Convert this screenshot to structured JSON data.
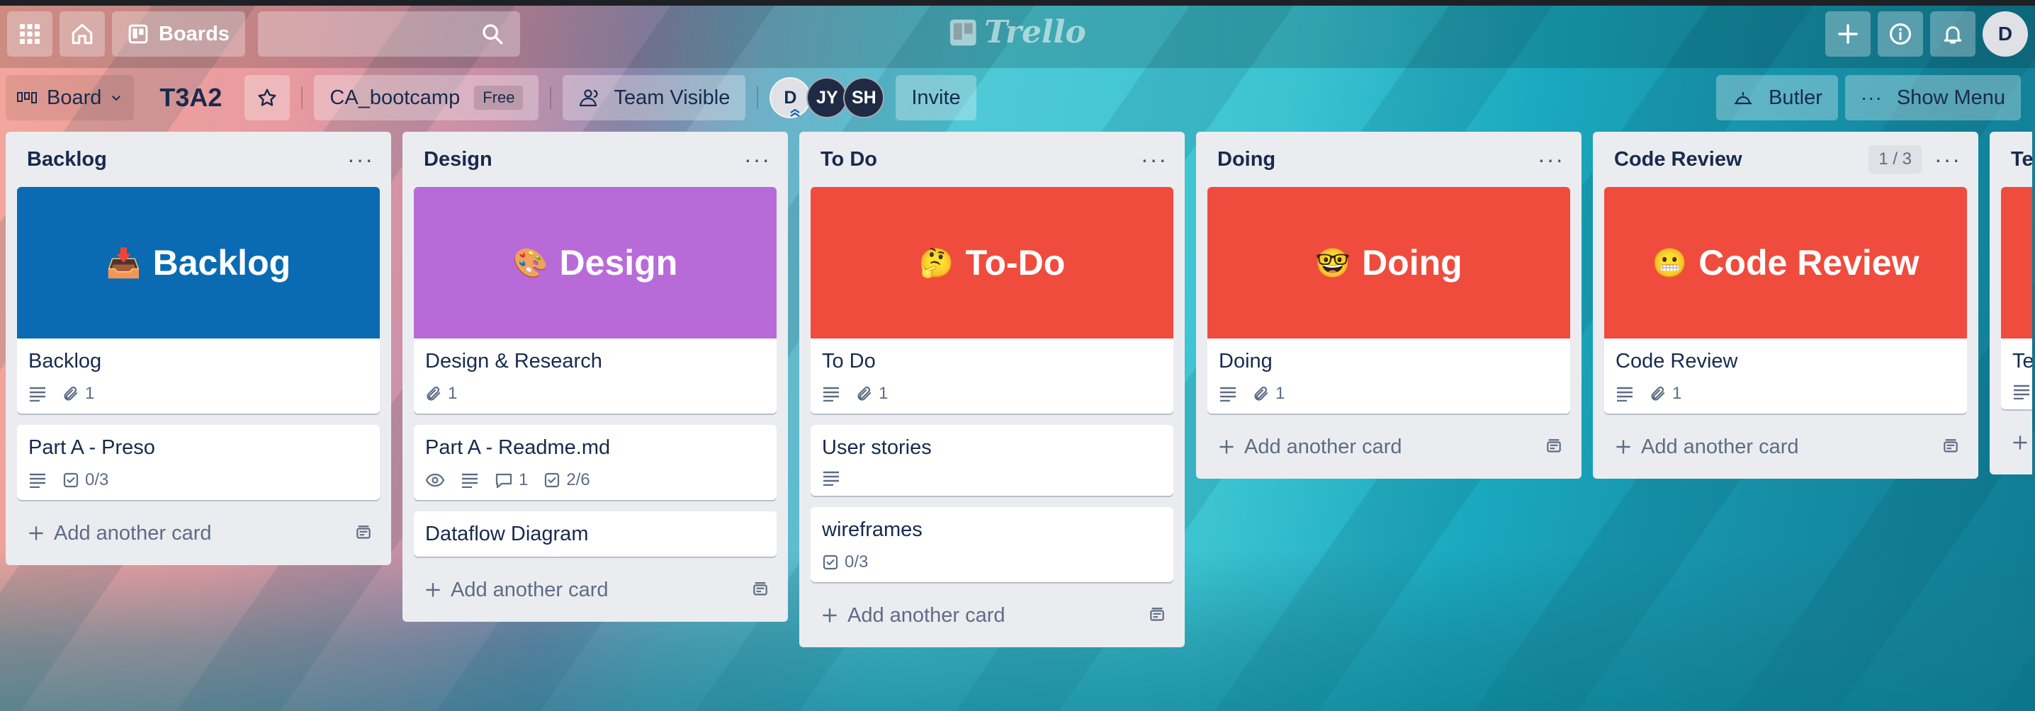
{
  "colors": {
    "backlog_cover": "#0a6bb3",
    "design_cover": "#b96ad9",
    "red_cover": "#ef4c3e",
    "accent": "#172b4d"
  },
  "topbar": {
    "boards_label": "Boards",
    "logo_text": "Trello",
    "user_initial": "D"
  },
  "boardbar": {
    "view_label": "Board",
    "board_title": "T3A2",
    "workspace": "CA_bootcamp",
    "workspace_plan": "Free",
    "visibility": "Team Visible",
    "members": [
      {
        "initials": "D",
        "bg": "#dfe1e6",
        "fg": "#172b4d"
      },
      {
        "initials": "JY",
        "bg": "#1f2a44",
        "fg": "#ffffff"
      },
      {
        "initials": "SH",
        "bg": "#1f2a44",
        "fg": "#ffffff"
      }
    ],
    "invite_label": "Invite",
    "butler_label": "Butler",
    "menu_label": "Show Menu"
  },
  "lists": [
    {
      "title": "Backlog",
      "cover": {
        "emoji": "📥",
        "text": "Backlog"
      },
      "cards": [
        {
          "title": "Backlog",
          "desc": true,
          "attachments": "1"
        },
        {
          "title": "Part A - Preso",
          "desc": true,
          "checklist": "0/3"
        }
      ],
      "add_label": "Add another card"
    },
    {
      "title": "Design",
      "cover": {
        "emoji": "🎨",
        "text": "Design"
      },
      "cards": [
        {
          "title": "Design & Research",
          "attachments": "1"
        },
        {
          "title": "Part A - Readme.md",
          "watch": true,
          "desc": true,
          "comments": "1",
          "checklist": "2/6"
        },
        {
          "title": "Dataflow Diagram"
        }
      ],
      "add_label": "Add another card"
    },
    {
      "title": "To Do",
      "cover": {
        "emoji": "🤔",
        "text": "To-Do"
      },
      "cards": [
        {
          "title": "To Do",
          "desc": true,
          "attachments": "1"
        },
        {
          "title": "User stories",
          "desc": true
        },
        {
          "title": "wireframes",
          "checklist": "0/3"
        }
      ],
      "add_label": "Add another card"
    },
    {
      "title": "Doing",
      "cover": {
        "emoji": "🤓",
        "text": "Doing"
      },
      "cards": [
        {
          "title": "Doing",
          "desc": true,
          "attachments": "1"
        }
      ],
      "add_label": "Add another card"
    },
    {
      "title": "Code Review",
      "count": "1 / 3",
      "cover": {
        "emoji": "😬",
        "text": "Code Review"
      },
      "cards": [
        {
          "title": "Code Review",
          "desc": true,
          "attachments": "1"
        }
      ],
      "add_label": "Add another card"
    },
    {
      "title": "Te",
      "cards": [
        {
          "title": "Te",
          "desc": true
        }
      ]
    }
  ]
}
